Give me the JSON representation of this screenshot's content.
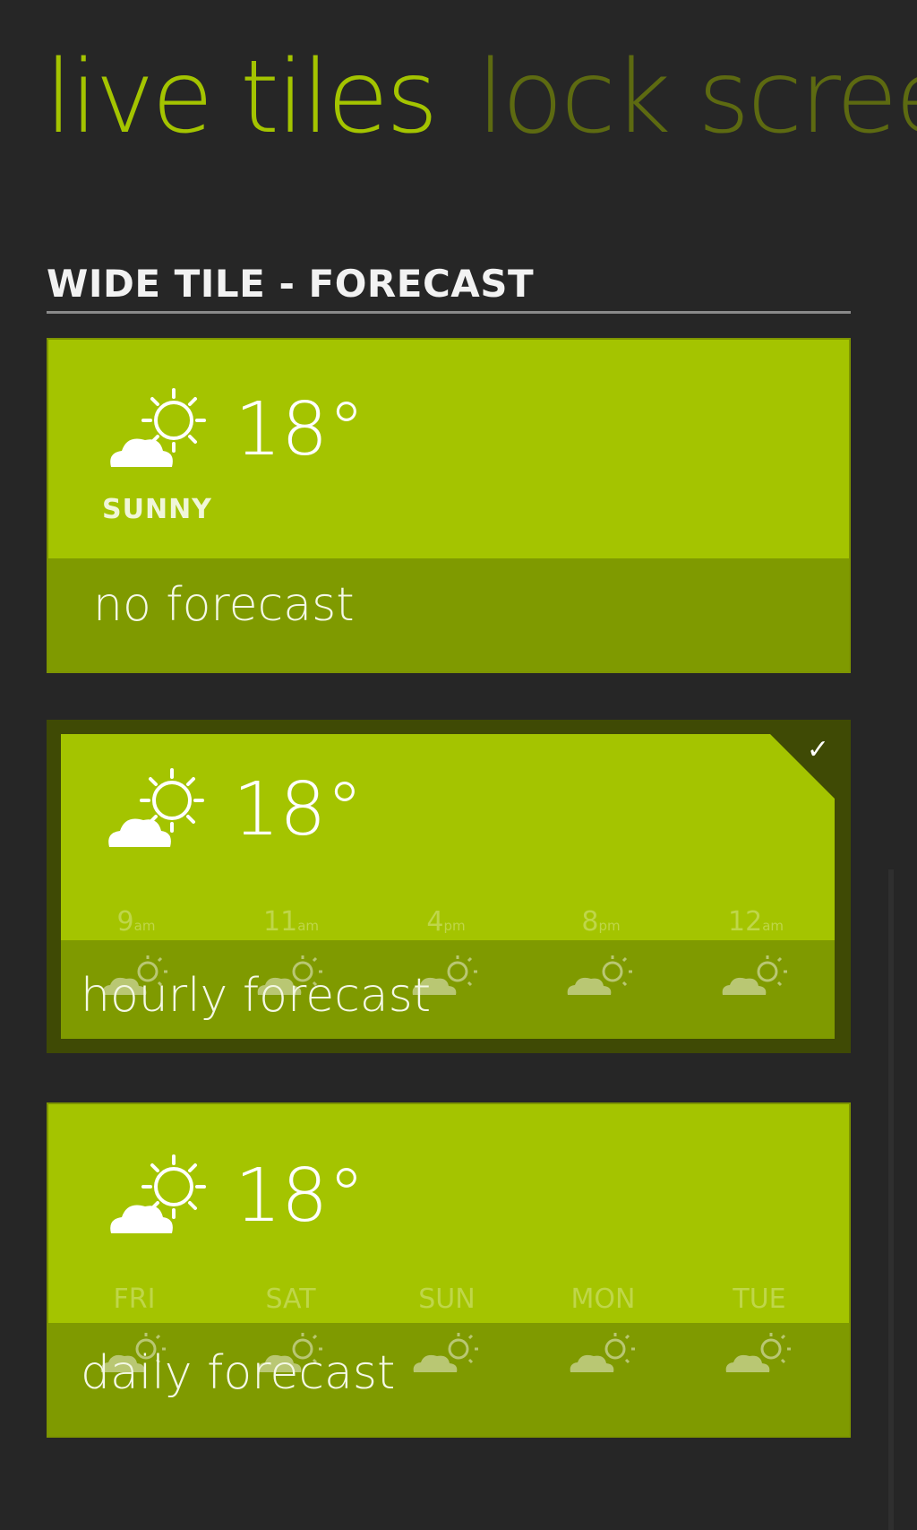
{
  "pivot": {
    "items": [
      "live tiles",
      "lock screen"
    ]
  },
  "section": {
    "title": "WIDE TILE - FORECAST"
  },
  "tiles": [
    {
      "temperature": "18°",
      "condition": "SUNNY",
      "label": "no forecast",
      "selected": false
    },
    {
      "temperature": "18°",
      "label": "hourly forecast",
      "selected": true,
      "forecast": [
        {
          "value": "9",
          "suffix": "am"
        },
        {
          "value": "11",
          "suffix": "am"
        },
        {
          "value": "4",
          "suffix": "pm"
        },
        {
          "value": "8",
          "suffix": "pm"
        },
        {
          "value": "12",
          "suffix": "am"
        }
      ]
    },
    {
      "temperature": "18°",
      "label": "daily forecast",
      "selected": false,
      "forecast": [
        {
          "value": "FRI"
        },
        {
          "value": "SAT"
        },
        {
          "value": "SUN"
        },
        {
          "value": "MON"
        },
        {
          "value": "TUE"
        }
      ]
    }
  ],
  "icons": {
    "weather": "partly-sunny-icon",
    "check": "checkmark-icon"
  },
  "colors": {
    "accent": "#a4c400",
    "strip": "#7f9a00",
    "background": "#262626",
    "inactive_pivot": "#5d6a11"
  }
}
